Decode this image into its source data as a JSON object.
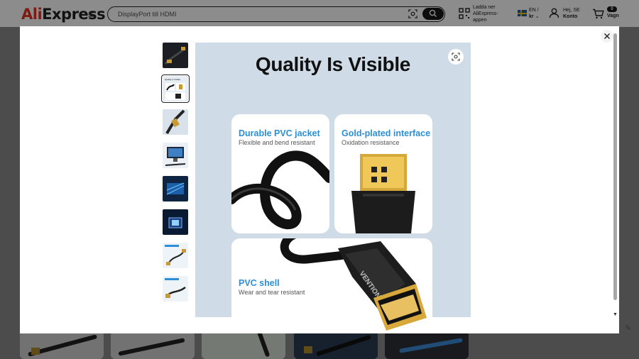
{
  "header": {
    "logo": {
      "ali": "Ali",
      "express": "Express"
    },
    "menu_icon": "≡",
    "search": {
      "value": "DisplayPort till HDMI"
    },
    "app_download": {
      "line1": "Ladda ner",
      "line2": "AliExpress-",
      "line3": "appen"
    },
    "lang": {
      "line1": "EN /",
      "line2": "kr"
    },
    "account": {
      "greeting": "Hej, SE",
      "label": "Konto"
    },
    "cart": {
      "count": "0",
      "label": "Vagn"
    }
  },
  "modal": {
    "thumbnails": [
      {
        "label": "",
        "active": false
      },
      {
        "label": "Quality is Visible",
        "active": true
      },
      {
        "label": "",
        "active": false
      },
      {
        "label": "",
        "active": false
      },
      {
        "label": "",
        "active": false
      },
      {
        "label": "",
        "active": false
      },
      {
        "label": "",
        "active": false
      },
      {
        "label": "",
        "active": false
      }
    ],
    "main_image": {
      "headline": "Quality Is Visible",
      "panels": [
        {
          "title": "Durable PVC jacket",
          "subtitle": "Flexible and bend resistant"
        },
        {
          "title": "Gold-plated interface",
          "subtitle": "Oxidation resistance"
        },
        {
          "title": "PVC shell",
          "subtitle": "Wear and tear resistant"
        }
      ],
      "brand_on_plug": "VENTION"
    }
  },
  "colors": {
    "brand_red": "#e43225",
    "accent_blue": "#2c8fd6",
    "image_bg": "#cfdbe6"
  }
}
